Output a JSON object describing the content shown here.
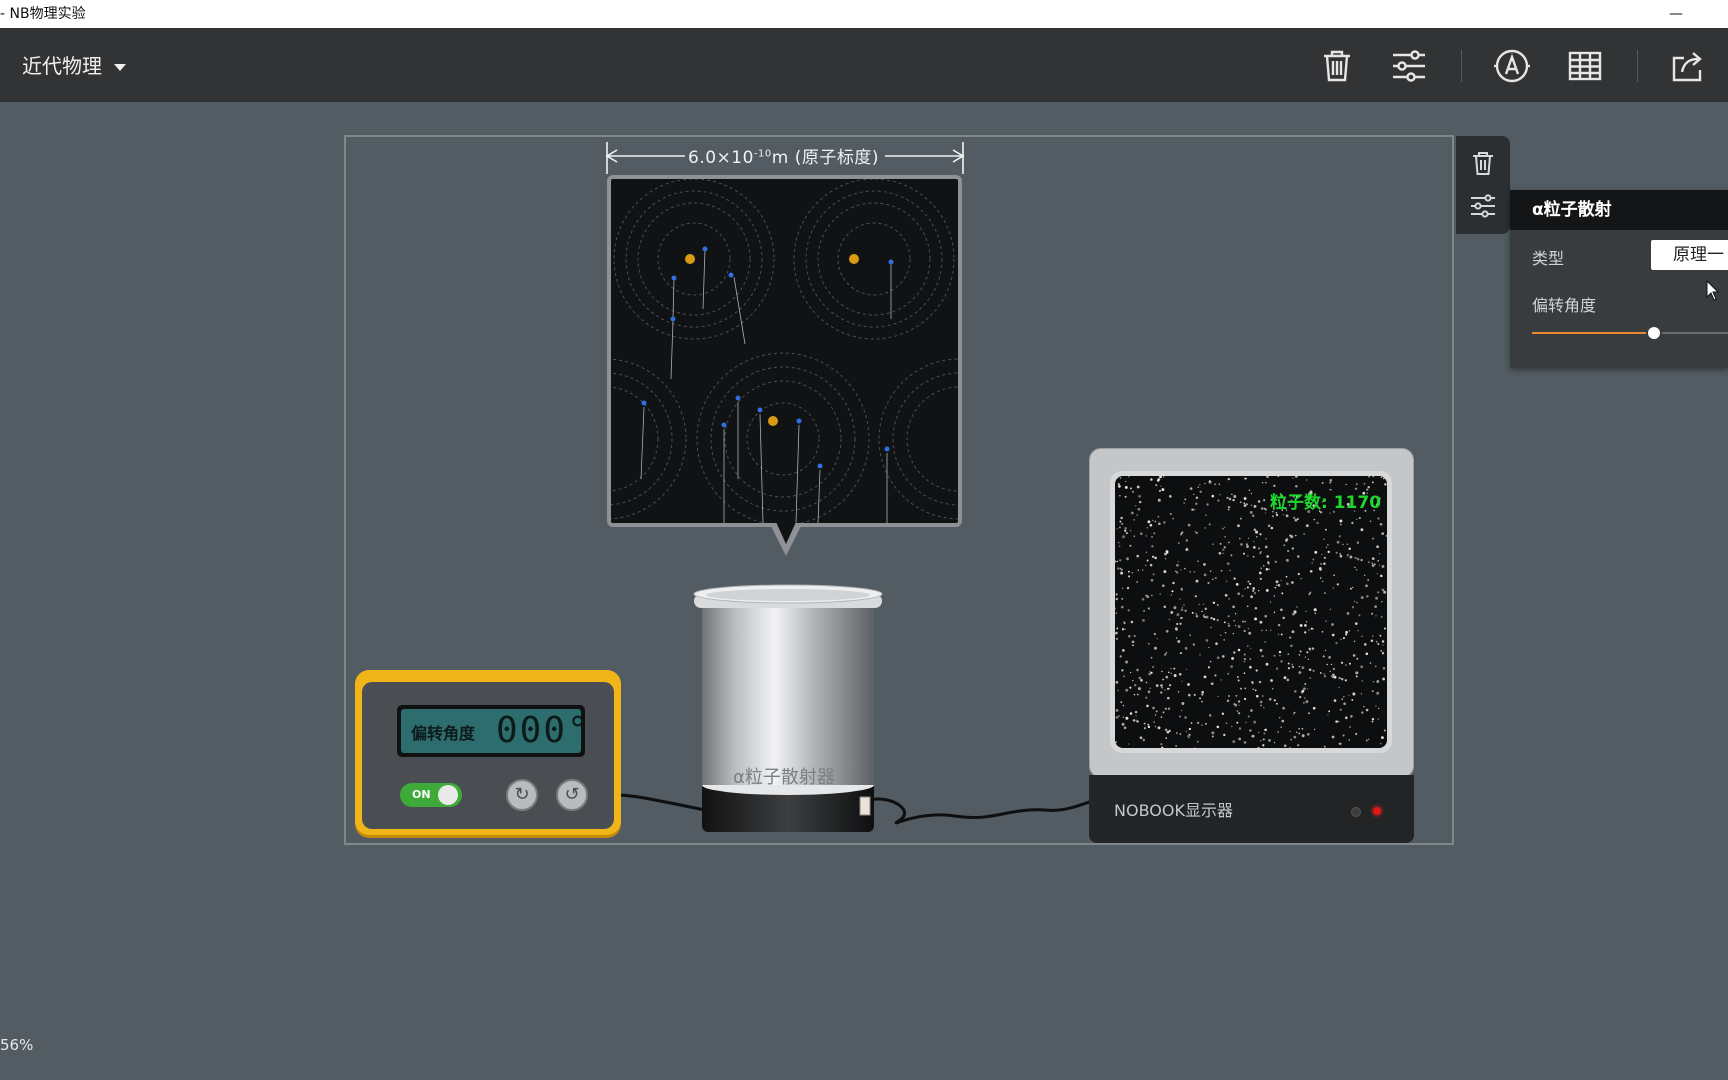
{
  "window": {
    "title": "- NB物理实验",
    "minimize_label": "—",
    "edge_label": ""
  },
  "toolbar": {
    "category_label": "近代物理",
    "icons": [
      "trash-icon",
      "sliders-icon",
      "text-label-icon",
      "table-icon",
      "share-icon"
    ]
  },
  "scale": {
    "prefix": "6.0×10",
    "exponent": "-10",
    "suffix": "m (原子标度)"
  },
  "counter_device": {
    "display_label": "偏转角度",
    "display_value": "000°",
    "power_label": "ON",
    "rotate_cw_symbol": "↻",
    "rotate_ccw_symbol": "↺"
  },
  "emitter": {
    "label": "α粒子散射器"
  },
  "monitor": {
    "count_text": "粒子数: 1170",
    "brand": "NOBOOK显示器"
  },
  "properties_panel": {
    "title": "α粒子散射",
    "type_label": "类型",
    "type_value": "原理一",
    "angle_label": "偏转角度",
    "angle_slider_fraction": 0.62
  },
  "status": {
    "zoom": "56%"
  },
  "colors": {
    "accent": "#e8872e",
    "counter_body": "#f0b619",
    "lcd": "#2d6d6e",
    "count_text": "#1fd72b",
    "nucleus": "#d99a14",
    "alpha_particle": "#2f6fe0"
  }
}
